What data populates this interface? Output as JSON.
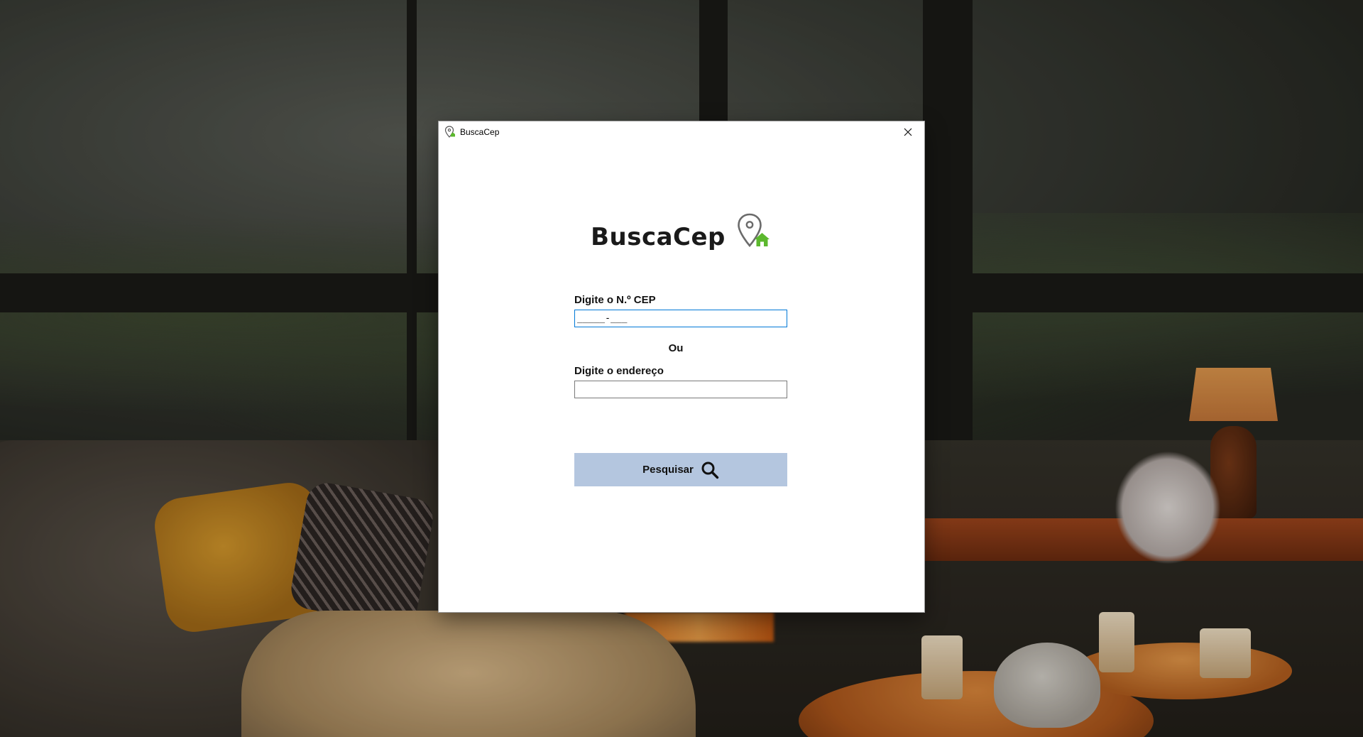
{
  "window": {
    "title": "BuscaCep"
  },
  "logo": {
    "text": "BuscaCep",
    "icon": "map-pin-home-icon",
    "accent_color": "#5cb82e"
  },
  "form": {
    "cep_label": "Digite o N.º CEP",
    "cep_value": "_____-___",
    "or_label": "Ou",
    "address_label": "Digite o endereço",
    "address_value": "",
    "search_button_label": "Pesquisar",
    "search_button_icon": "search-icon",
    "search_button_color": "#b4c6df"
  }
}
